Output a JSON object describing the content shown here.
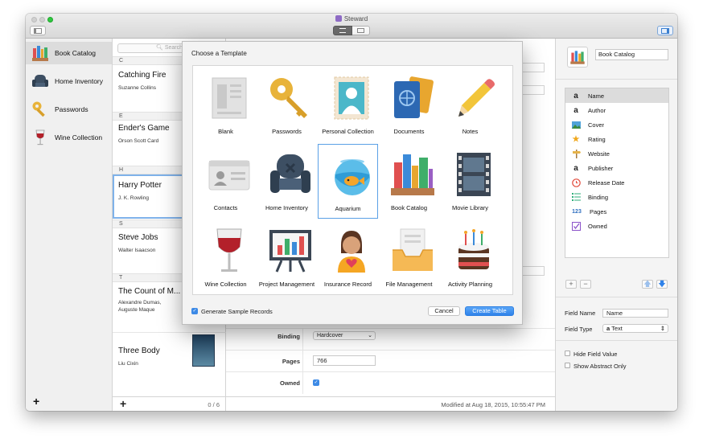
{
  "window": {
    "title": "Steward"
  },
  "sidebar": {
    "items": [
      {
        "label": "Book Catalog",
        "icon": "books-icon",
        "selected": true
      },
      {
        "label": "Home Inventory",
        "icon": "armchair-icon",
        "selected": false
      },
      {
        "label": "Passwords",
        "icon": "key-icon",
        "selected": false
      },
      {
        "label": "Wine Collection",
        "icon": "wine-glass-icon",
        "selected": false
      }
    ]
  },
  "list": {
    "search_placeholder": "Search",
    "sections": [
      {
        "letter": "C",
        "records": [
          {
            "title": "Catching Fire",
            "sub": "Suzanne Collins"
          }
        ]
      },
      {
        "letter": "E",
        "records": [
          {
            "title": "Ender's Game",
            "sub": "Orson Scott Card"
          }
        ]
      },
      {
        "letter": "H",
        "records": [
          {
            "title": "Harry Potter",
            "sub": "J. K. Rowling"
          }
        ]
      },
      {
        "letter": "S",
        "records": [
          {
            "title": "Steve Jobs",
            "sub": "Walter Isaacson"
          }
        ]
      },
      {
        "letter": "T",
        "records": [
          {
            "title": "The Count of M...",
            "sub1": "Alexandre Dumas,",
            "sub2": "Auguste Maque"
          },
          {
            "title": "Three Body",
            "sub": "Liu Cixin"
          }
        ]
      }
    ],
    "count": "0 / 6"
  },
  "detail": {
    "binding_label": "Binding",
    "binding_value": "Hardcover",
    "pages_label": "Pages",
    "pages_value": "766",
    "owned_label": "Owned",
    "owned": true,
    "modified": "Modified at Aug 18, 2015, 10:55:47 PM"
  },
  "inspector": {
    "table_name": "Book Catalog",
    "fields": [
      {
        "label": "Name",
        "icon": "text-a-icon",
        "selected": true
      },
      {
        "label": "Author",
        "icon": "text-a-icon"
      },
      {
        "label": "Cover",
        "icon": "image-icon"
      },
      {
        "label": "Rating",
        "icon": "star-icon"
      },
      {
        "label": "Website",
        "icon": "signpost-icon"
      },
      {
        "label": "Publisher",
        "icon": "text-a-icon"
      },
      {
        "label": "Release Date",
        "icon": "clock-icon"
      },
      {
        "label": "Binding",
        "icon": "list-icon"
      },
      {
        "label": "Pages",
        "icon": "number-icon"
      },
      {
        "label": "Owned",
        "icon": "checkbox-icon"
      }
    ],
    "field_name_label": "Field Name",
    "field_name_value": "Name",
    "field_type_label": "Field Type",
    "field_type_value": "Text",
    "field_type_glyph": "a",
    "number_glyph": "123",
    "hide_label": "Hide Field Value",
    "abstract_label": "Show Abstract Only"
  },
  "modal": {
    "title": "Choose a Template",
    "templates": [
      {
        "label": "Blank",
        "icon": "blank-doc-icon"
      },
      {
        "label": "Passwords",
        "icon": "key-icon"
      },
      {
        "label": "Personal Collection",
        "icon": "stamp-icon"
      },
      {
        "label": "Documents",
        "icon": "passport-icon"
      },
      {
        "label": "Notes",
        "icon": "pencil-icon"
      },
      {
        "label": "Contacts",
        "icon": "id-card-icon"
      },
      {
        "label": "Home Inventory",
        "icon": "armchair-icon"
      },
      {
        "label": "Aquarium",
        "icon": "fishbowl-icon",
        "selected": true
      },
      {
        "label": "Book Catalog",
        "icon": "books-icon"
      },
      {
        "label": "Movie Library",
        "icon": "film-strip-icon"
      },
      {
        "label": "Wine Collection",
        "icon": "wine-glass-icon"
      },
      {
        "label": "Project Management",
        "icon": "presentation-chart-icon"
      },
      {
        "label": "Insurance Record",
        "icon": "person-heart-icon"
      },
      {
        "label": "File Management",
        "icon": "inbox-tray-icon"
      },
      {
        "label": "Activity Planning",
        "icon": "birthday-cake-icon"
      }
    ],
    "sample_label": "Generate Sample Records",
    "sample_checked": true,
    "cancel_label": "Cancel",
    "create_label": "Create Table"
  },
  "colors": {
    "accent": "#2f82ea",
    "selection": "#dcdcdc"
  }
}
